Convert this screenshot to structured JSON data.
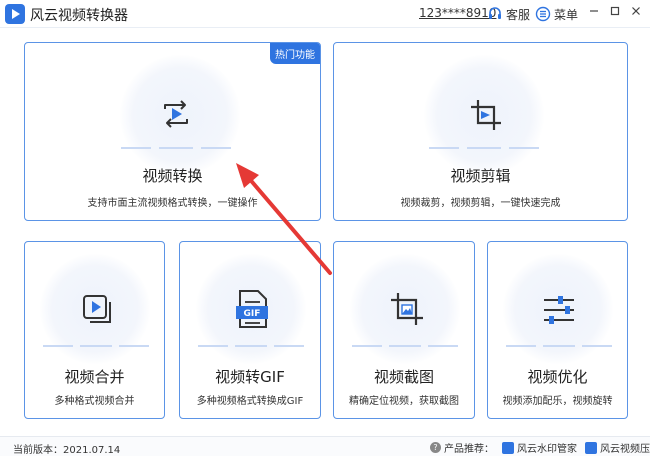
{
  "app": {
    "title": "风云视频转换器"
  },
  "header": {
    "phone": "123****8910",
    "service_label": "客服",
    "menu_label": "菜单"
  },
  "colors": {
    "accent": "#2f74e0",
    "arrow": "#e53935",
    "card_border": "#5b94e6"
  },
  "cards": [
    {
      "title": "视频转换",
      "desc": "支持市面主流视频格式转换，一键操作",
      "badge": "热门功能",
      "icon": "convert-icon"
    },
    {
      "title": "视频剪辑",
      "desc": "视频裁剪，视频剪辑，一键快速完成",
      "icon": "crop-icon"
    },
    {
      "title": "视频合并",
      "desc": "多种格式视频合并",
      "icon": "merge-icon"
    },
    {
      "title": "视频转GIF",
      "desc": "多种视频格式转换成GIF",
      "icon": "gif-file-icon",
      "icon_text": "GIF"
    },
    {
      "title": "视频截图",
      "desc": "精确定位视频，获取截图",
      "icon": "screenshot-icon"
    },
    {
      "title": "视频优化",
      "desc": "视频添加配乐，视频旋转",
      "icon": "sliders-icon"
    }
  ],
  "footer": {
    "version": "当前版本：2021.07.14",
    "recommend_label": "产品推荐：",
    "products": [
      "风云水印管家",
      "风云视频压缩"
    ]
  }
}
